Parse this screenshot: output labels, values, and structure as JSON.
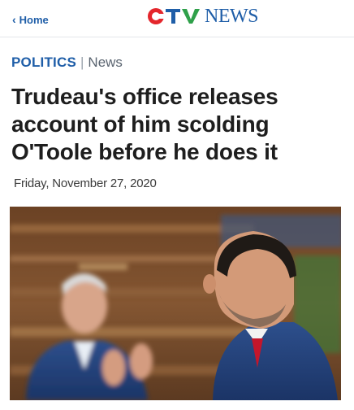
{
  "header": {
    "home_label": "Home",
    "logo": {
      "brand_letters": "CTV",
      "brand_word": "NEWS",
      "colors": {
        "c": "#e4262c",
        "t": "#1f5ea8",
        "v": "#2fa04a",
        "news": "#1f5ea8"
      }
    }
  },
  "article": {
    "section": "POLITICS",
    "separator": "|",
    "subsection": "News",
    "headline": "Trudeau's office releases account of him scolding O'Toole before he does it",
    "date": "Friday, November 27, 2020"
  },
  "colors": {
    "accent": "#1f5ea8",
    "headline_text": "#1e1e1e"
  },
  "icons": {
    "back": "chevron-left-icon"
  }
}
